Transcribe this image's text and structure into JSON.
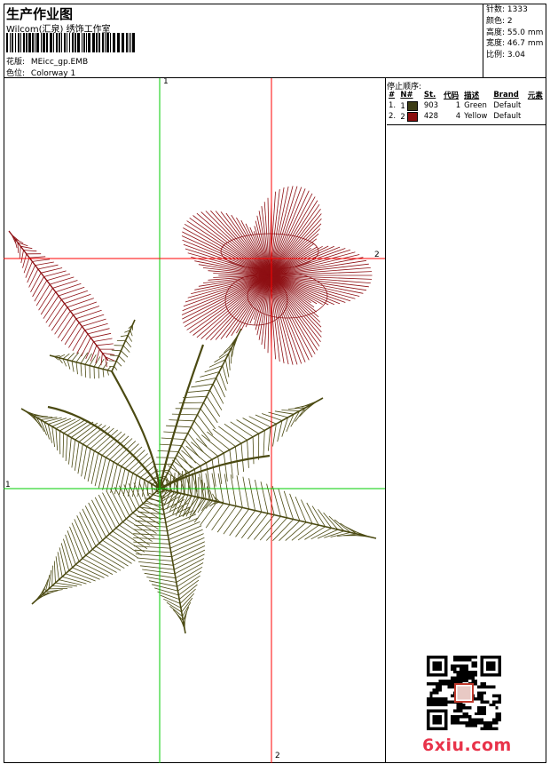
{
  "header": {
    "title": "生产作业图",
    "subtitle": "Wilcom(汇泉) 绣饰工作室",
    "design_label": "花版:",
    "design_name": "MEicc_gp.EMB",
    "colorway_label": "色位:",
    "colorway_name": "Colorway 1"
  },
  "stats": {
    "stitches_label": "针数:",
    "stitches": "1333",
    "colors_label": "颜色:",
    "colors": "2",
    "height_label": "高度:",
    "height": "55.0 mm",
    "width_label": "宽度:",
    "width": "46.7 mm",
    "ratio_label": "比例:",
    "ratio": "3.04"
  },
  "stop_sequence": {
    "title": "停止顺序:",
    "headers": [
      "#",
      "N#",
      "St.",
      "代码",
      "描述",
      "Brand",
      "元素"
    ],
    "rows": [
      {
        "num": "1.",
        "n": "1",
        "color": "#3d3d16",
        "st": "903",
        "code": "1",
        "desc": "Green",
        "brand": "Default"
      },
      {
        "num": "2.",
        "n": "2",
        "color": "#8b0f0f",
        "st": "428",
        "code": "4",
        "desc": "Yellow",
        "brand": "Default"
      }
    ]
  },
  "guides": {
    "v1": "1",
    "v2": "2",
    "h1": "1",
    "h2": "2"
  },
  "colors": {
    "green_thread": "#4b4a12",
    "red_thread": "#8e1014",
    "guide_green": "#00cc00",
    "guide_red": "#ff0000",
    "logo": "#e8334a"
  },
  "watermark": {
    "logo_text": "6xiu.com"
  }
}
